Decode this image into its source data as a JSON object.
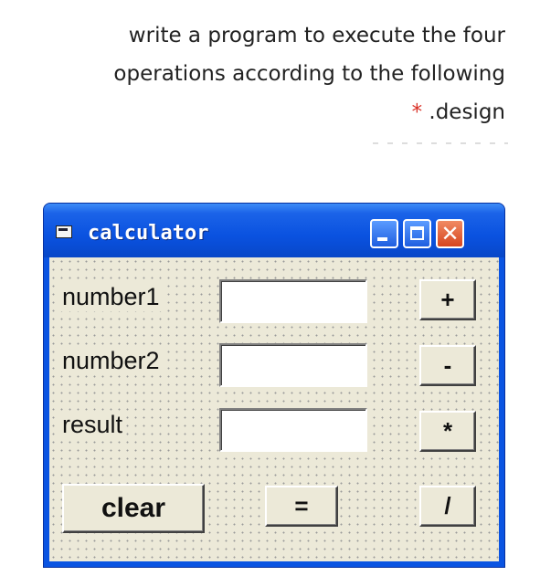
{
  "question": {
    "line1": "write a program to execute the four",
    "line2": "operations according to the following",
    "star": "*",
    "line3": " .design"
  },
  "window": {
    "title": "calculator",
    "controls": {
      "minimize": "minimize-icon",
      "maximize": "maximize-icon",
      "close": "✕"
    }
  },
  "form": {
    "labels": {
      "number1": "number1",
      "number2": "number2",
      "result": "result"
    },
    "inputs": {
      "number1": "",
      "number2": "",
      "result": ""
    },
    "buttons": {
      "add": "+",
      "subtract": "-",
      "multiply": "*",
      "divide": "/",
      "clear": "clear",
      "equals": "="
    }
  }
}
